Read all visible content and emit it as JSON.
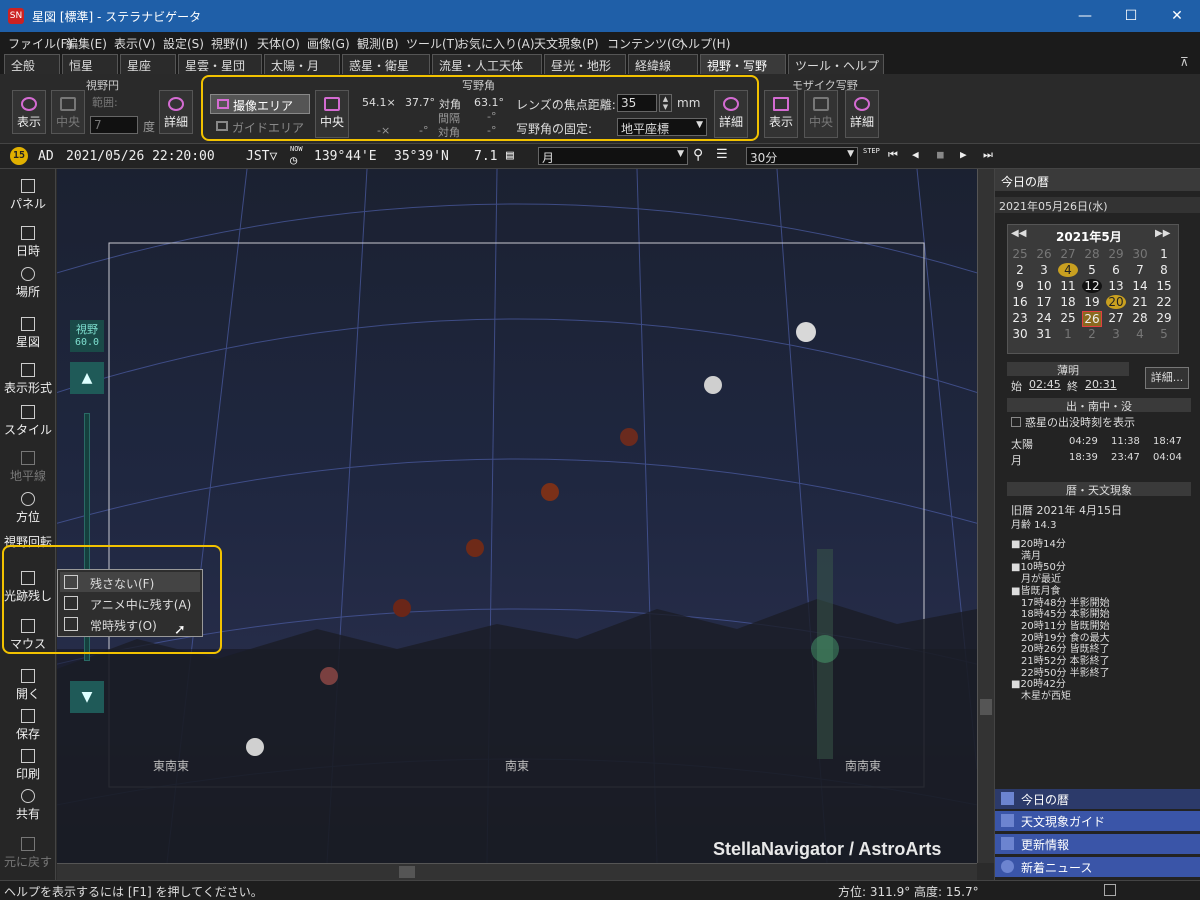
{
  "window": {
    "title": "星図 [標準] - ステラナビゲータ",
    "logo": "SN",
    "min": "—",
    "max": "☐",
    "close": "✕"
  },
  "menu": [
    "ファイル(F)",
    "編集(E)",
    "表示(V)",
    "設定(S)",
    "視野(I)",
    "天体(O)",
    "画像(G)",
    "観測(B)",
    "ツール(T)",
    "お気に入り(A)",
    "天文現象(P)",
    "コンテンツ(C)",
    "ヘルプ(H)"
  ],
  "tabs": [
    "全般",
    "恒星",
    "星座",
    "星雲・星団",
    "太陽・月",
    "惑星・衛星",
    "流星・人工天体",
    "昼光・地形",
    "経緯線",
    "視野・写野",
    "ツール・ヘルプ"
  ],
  "tab_pin": "⊼",
  "ribbon": {
    "fov": {
      "title": "視野円",
      "show": "表示",
      "center": "中央",
      "range_label": "範囲:",
      "range_value": "7",
      "unit": "度",
      "detail": "詳細"
    },
    "photo": {
      "title": "写野角",
      "capture_area": "撮像エリア",
      "guide_area": "ガイドエリア",
      "center": "中央",
      "w": "54.1×",
      "h": "37.7°",
      "diag_label": "対角",
      "diag": "63.1°",
      "w2": "-×",
      "h2": "-°",
      "gap_label": "間隔",
      "gap": "-°",
      "diag2_label": "対角",
      "diag2": "-°",
      "focal_label": "レンズの焦点距離:",
      "focal": "35",
      "focal_unit": "mm",
      "fix_label": "写野角の固定:",
      "fix_value": "地平座標",
      "detail": "詳細"
    },
    "mosaic": {
      "title": "モザイク写野",
      "show": "表示",
      "center": "中央",
      "detail": "詳細"
    }
  },
  "infobar": {
    "badge": "15",
    "era": "AD",
    "datetime": "2021/05/26 22:20:00",
    "tz": "JST▽",
    "now": "NOW",
    "lon": "139°44'E",
    "lat": "35°39'N",
    "zoom": "7.1",
    "target": "月",
    "step": "30分",
    "step_label": "STEP"
  },
  "lefttools": [
    "パネル",
    "日時",
    "場所",
    "星図",
    "表示形式",
    "スタイル",
    "地平線",
    "方位",
    "視野回転",
    "光跡残し",
    "マウス",
    "開く",
    "保存",
    "印刷",
    "共有",
    "元に戻す"
  ],
  "fov_slider": {
    "label": "視野",
    "value": "60.0"
  },
  "trail_menu": [
    "残さない(F)",
    "アニメ中に残す(A)",
    "常時残す(O)"
  ],
  "sky": {
    "directions": [
      "東南東",
      "南東",
      "南南東"
    ],
    "watermark": "StellaNavigator / AstroArts"
  },
  "right": {
    "head": "今日の暦",
    "date": "2021年05月26日(水)",
    "month_title": "2021年5月",
    "nav_prev2": "◀◀",
    "nav_prev": "◀",
    "nav_next": "▶",
    "nav_next2": "▶▶",
    "cal": [
      [
        "25",
        "26",
        "27",
        "28",
        "29",
        "30",
        "1"
      ],
      [
        "2",
        "3",
        "4",
        "5",
        "6",
        "7",
        "8"
      ],
      [
        "9",
        "10",
        "11",
        "12",
        "13",
        "14",
        "15"
      ],
      [
        "16",
        "17",
        "18",
        "19",
        "20",
        "21",
        "22"
      ],
      [
        "23",
        "24",
        "25",
        "26",
        "27",
        "28",
        "29"
      ],
      [
        "30",
        "31",
        "1",
        "2",
        "3",
        "4",
        "5"
      ]
    ],
    "twilight_head": "薄明",
    "tw_start_label": "始",
    "tw_start": "02:45",
    "tw_end_label": "終",
    "tw_end": "20:31",
    "detail": "詳細...",
    "rise_head": "出・南中・没",
    "planet_check": "惑星の出没時刻を表示",
    "rise": [
      {
        "name": "太陽",
        "rise": "04:29",
        "transit": "11:38",
        "set": "18:47"
      },
      {
        "name": "月",
        "rise": "18:39",
        "transit": "23:47",
        "set": "04:04"
      }
    ],
    "cal_head": "暦・天文現象",
    "kyureki": "旧暦  2021年 4月15日",
    "moonage": "月齢 14.3",
    "events": [
      "■20時14分",
      "　満月",
      "■10時50分",
      "　月が最近",
      "■皆既月食",
      "　17時48分 半影開始",
      "　18時45分 本影開始",
      "　20時11分 皆既開始",
      "　20時19分 食の最大",
      "　20時26分 皆既終了",
      "　21時52分 本影終了",
      "　22時50分 半影終了",
      "■20時42分",
      "　木星が西矩"
    ],
    "nav": [
      "今日の暦",
      "天文現象ガイド",
      "更新情報",
      "新着ニュース"
    ]
  },
  "status": {
    "help": "ヘルプを表示するには [F1] を押してください。",
    "coord": "方位: 311.9°  高度: 15.7°"
  }
}
